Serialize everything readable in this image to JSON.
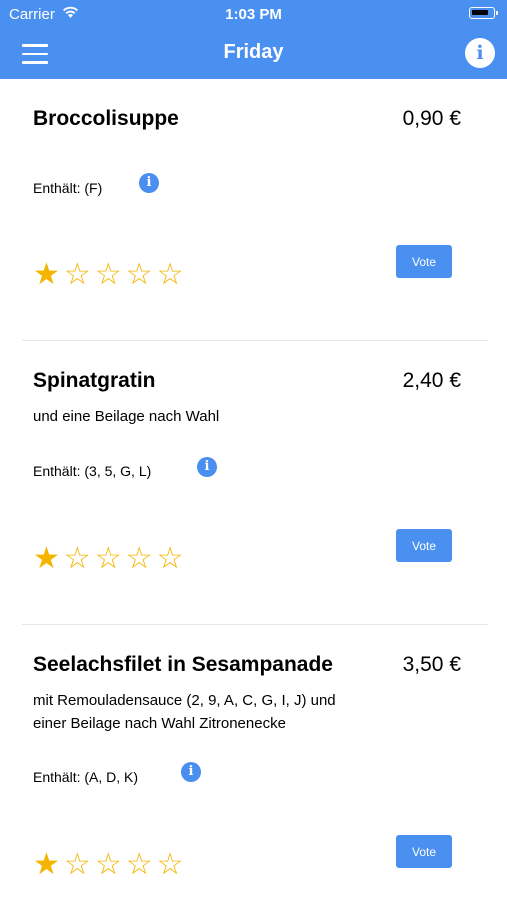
{
  "status_bar": {
    "carrier": "Carrier",
    "time": "1:03 PM"
  },
  "nav": {
    "title": "Friday",
    "info_glyph": "i"
  },
  "vote_label": "Vote",
  "info_glyph": "i",
  "dishes": [
    {
      "name": "Broccolisuppe",
      "price": "0,90 €",
      "description": "",
      "allergens": "Enthält: (F)",
      "rating": 1,
      "stars": [
        "★",
        "☆",
        "☆",
        "☆",
        "☆"
      ]
    },
    {
      "name": "Spinatgratin",
      "price": "2,40 €",
      "description": "und eine Beilage nach Wahl",
      "allergens": "Enthält: (3, 5, G, L)",
      "rating": 1,
      "stars": [
        "★",
        "☆",
        "☆",
        "☆",
        "☆"
      ]
    },
    {
      "name": "Seelachsfilet in Sesampanade",
      "price": "3,50 €",
      "description": "mit Remouladensauce (2, 9, A, C, G, I, J) und einer Beilage nach Wahl Zitronenecke",
      "allergens": "Enthält: (A, D, K)",
      "rating": 1,
      "stars": [
        "★",
        "☆",
        "☆",
        "☆",
        "☆"
      ]
    }
  ]
}
